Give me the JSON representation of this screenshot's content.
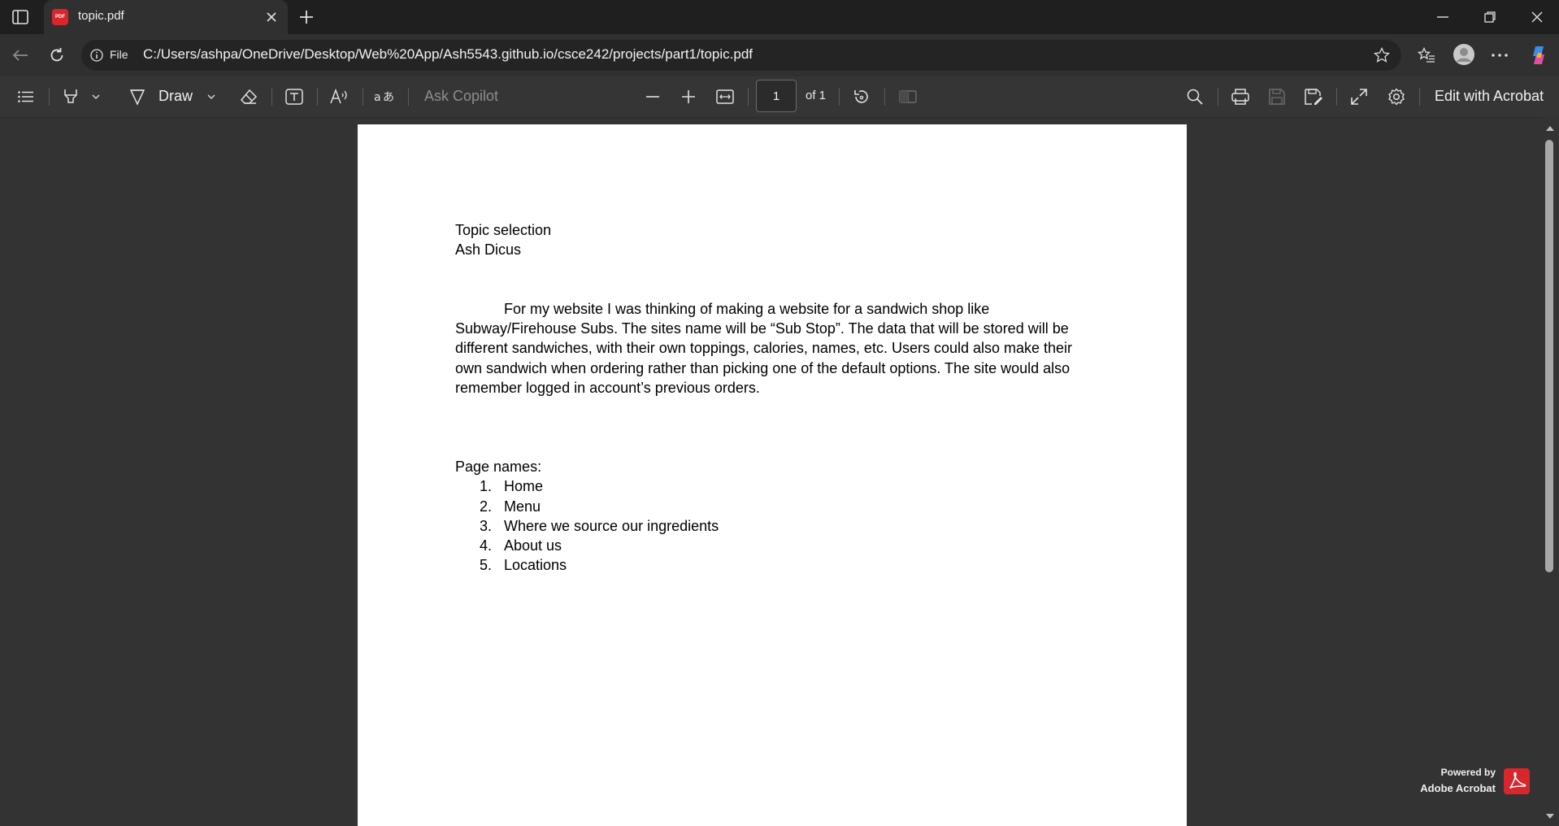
{
  "browser": {
    "tab": {
      "title": "topic.pdf",
      "favicon_label": "PDF"
    },
    "address": {
      "scheme_label": "File",
      "url": "C:/Users/ashpa/OneDrive/Desktop/Web%20App/Ash5543.github.io/csce242/projects/part1/topic.pdf"
    }
  },
  "toolbar": {
    "draw_label": "Draw",
    "ask_copilot": "Ask Copilot",
    "page_input": "1",
    "page_total": "of 1",
    "edit_label": "Edit with Acrobat"
  },
  "document": {
    "title": "Topic selection",
    "author": "Ash Dicus",
    "paragraph_lines": [
      "For my website I was thinking of making a website for a sandwich shop like",
      "Subway/Firehouse Subs. The sites name will be “Sub Stop”. The data that will be stored will be",
      "different sandwiches, with their own toppings, calories, names, etc. Users could also make their",
      "own sandwich when ordering rather than picking one of the default options. The site would also",
      "remember logged in account’s previous orders."
    ],
    "list_heading": "Page names:",
    "list_items": [
      {
        "num": "1.",
        "text": "Home"
      },
      {
        "num": "2.",
        "text": "Menu"
      },
      {
        "num": "3.",
        "text": "Where we source our ingredients"
      },
      {
        "num": "4.",
        "text": "About us"
      },
      {
        "num": "5.",
        "text": "Locations"
      }
    ]
  },
  "watermark": {
    "line1": "Powered by",
    "line2": "Adobe Acrobat"
  },
  "colors": {
    "accent_red": "#d7262c",
    "page_bg": "#ffffff",
    "viewer_bg": "#333333"
  },
  "icons": [
    "sidebar-toggle-icon",
    "pdf-favicon-icon",
    "close-icon",
    "new-tab-icon",
    "minimize-icon",
    "restore-icon",
    "window-close-icon",
    "back-icon",
    "refresh-icon",
    "info-icon",
    "favorite-star-icon",
    "favorites-icon",
    "profile-icon",
    "more-icon",
    "copilot-icon",
    "contents-icon",
    "highlight-icon",
    "draw-icon",
    "eraser-icon",
    "text-box-icon",
    "read-aloud-icon",
    "translate-icon",
    "zoom-out-icon",
    "zoom-in-icon",
    "fit-width-icon",
    "rotate-icon",
    "two-page-icon",
    "search-icon",
    "print-icon",
    "save-icon",
    "save-as-icon",
    "fullscreen-icon",
    "settings-icon",
    "acrobat-logo-icon"
  ]
}
